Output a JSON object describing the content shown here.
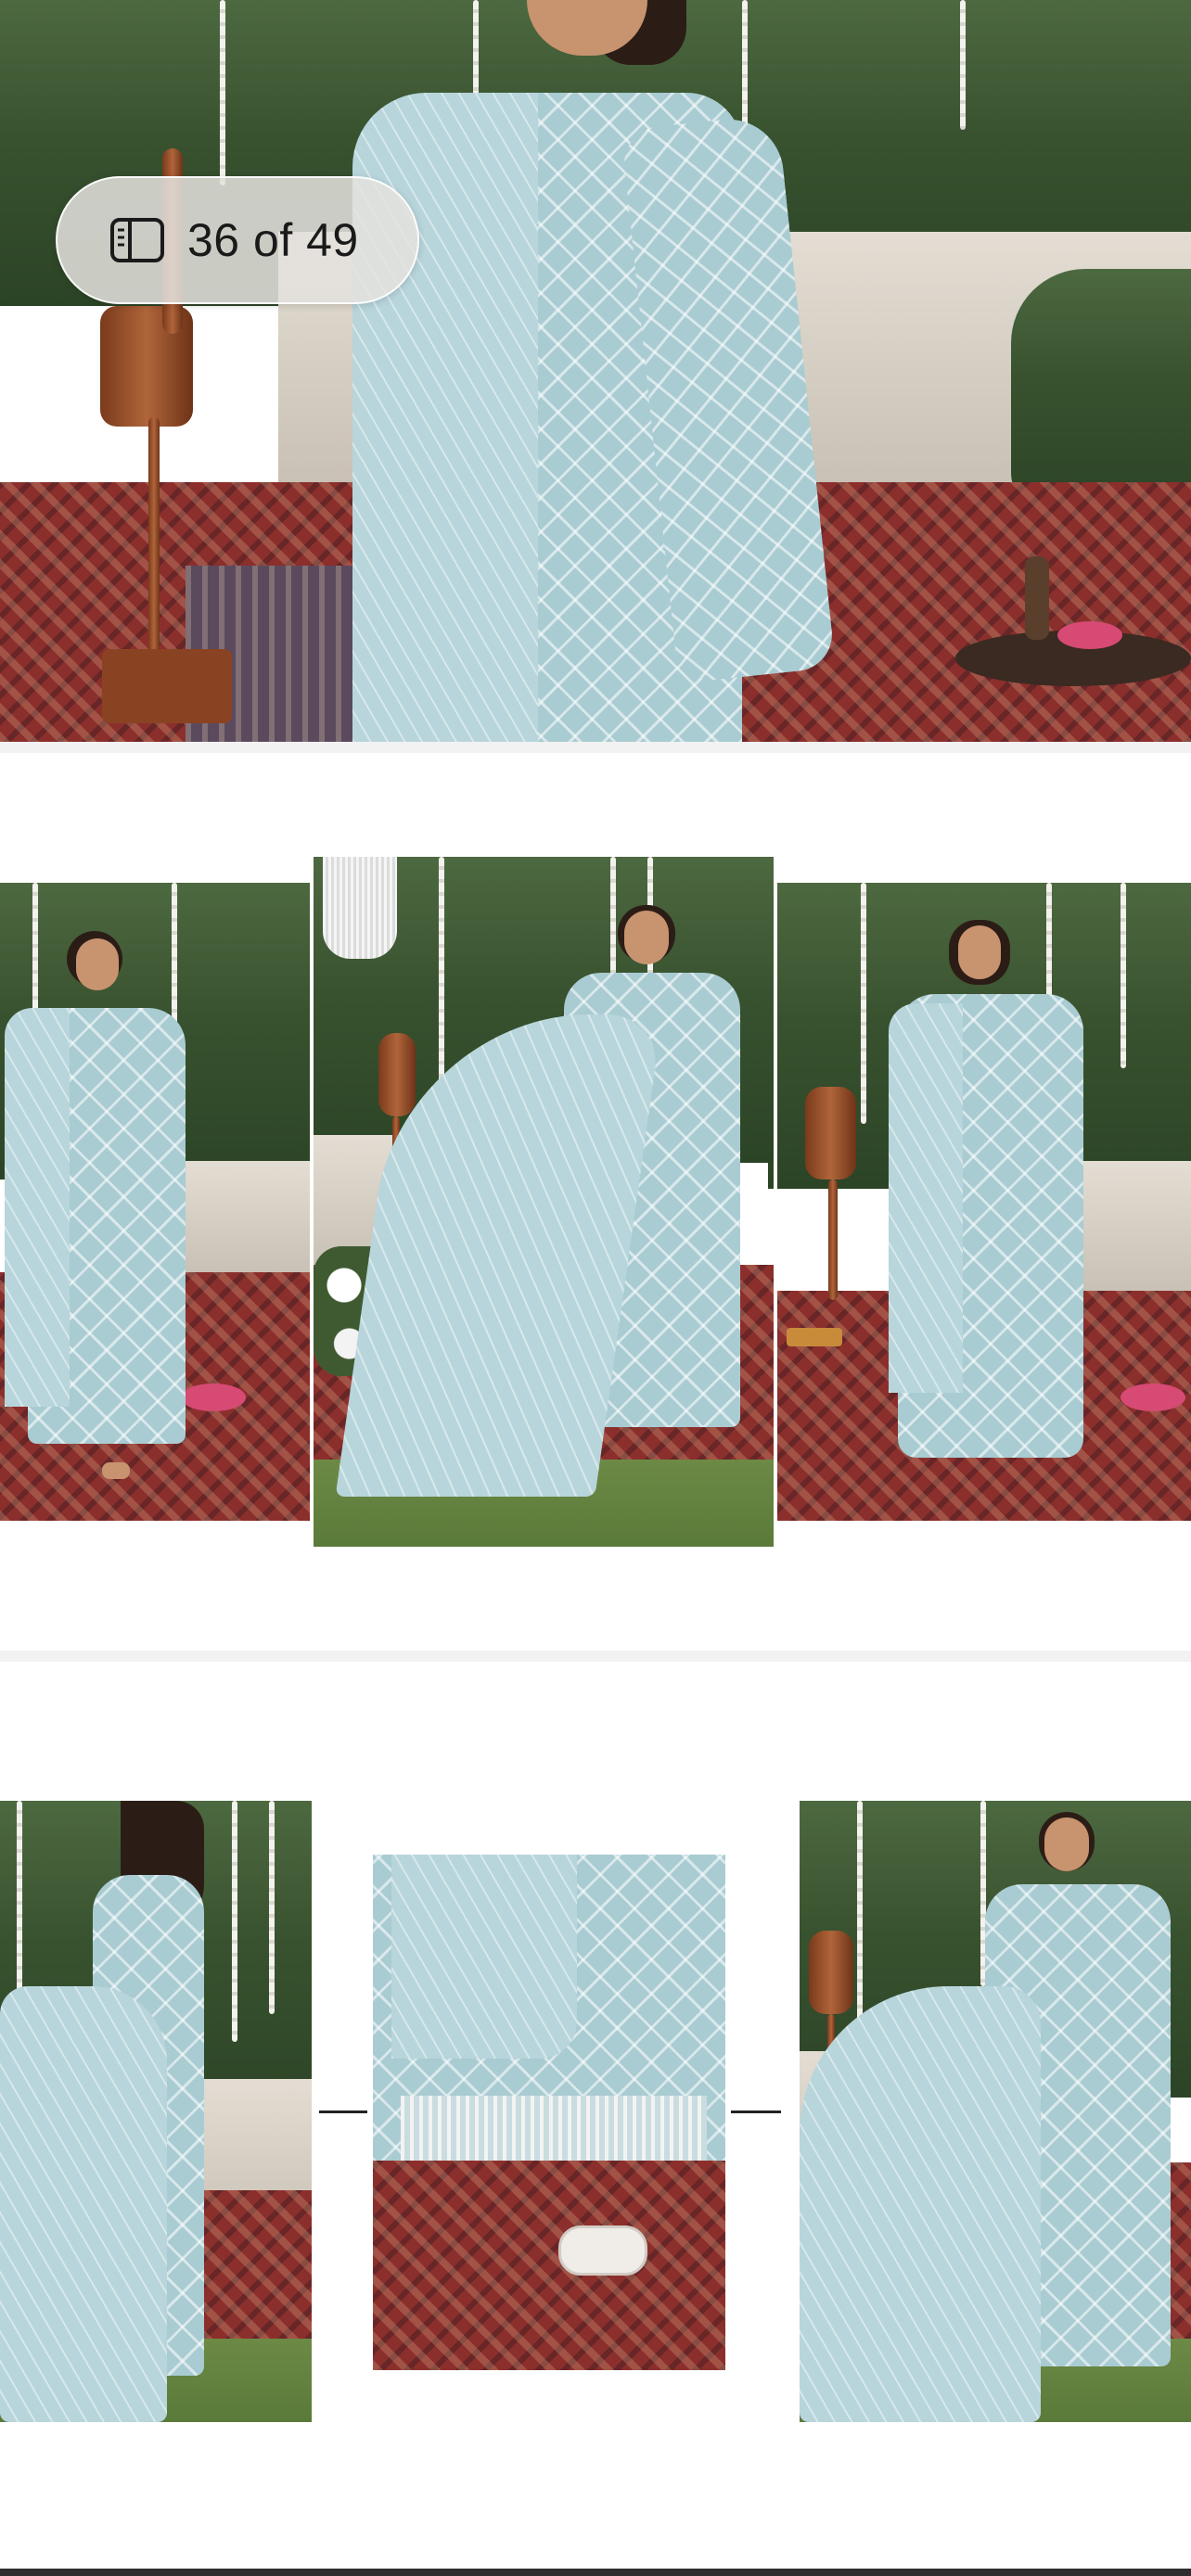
{
  "gallery": {
    "counter": {
      "icon": "gallery-sidebar-icon",
      "current": 36,
      "total": 49,
      "label": "36 of 49"
    }
  },
  "colors": {
    "dress": "#a9cbd2",
    "background": "#ffffff"
  }
}
